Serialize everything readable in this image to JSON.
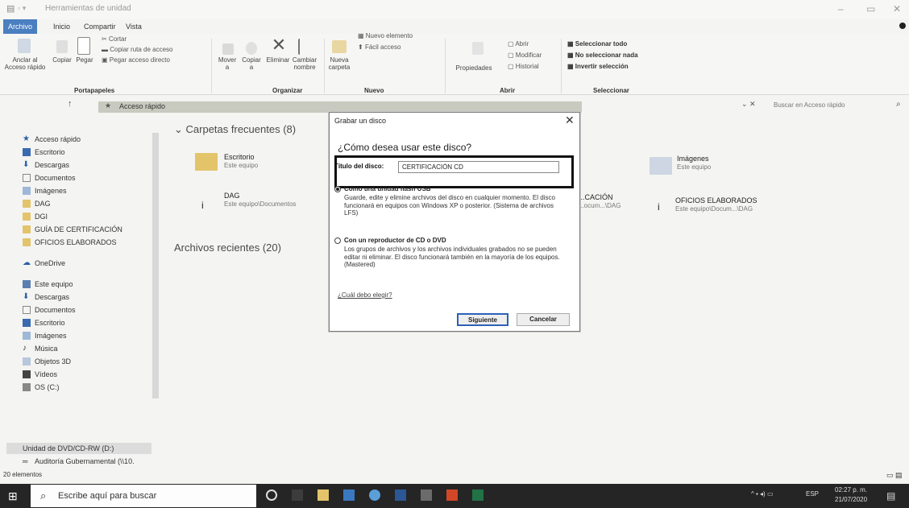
{
  "window": {
    "title": "Herramientas de unidad",
    "tabs": [
      "Archivo",
      "Inicio",
      "Compartir",
      "Vista"
    ]
  },
  "ribbon": {
    "portapapeles": {
      "pin_label": "Anclar al Acceso rápido",
      "copy_label": "Copiar",
      "paste_label": "Pegar",
      "cut_label": "Cortar",
      "copy_path_label": "Copiar ruta de acceso",
      "paste_shortcut_label": "Pegar acceso directo",
      "group_label": "Portapapeles"
    },
    "organizar": {
      "move_label": "Mover a",
      "copy_to_label": "Copiar a",
      "delete_label": "Eliminar",
      "rename_label": "Cambiar nombre",
      "group_label": "Organizar"
    },
    "nuevo": {
      "new_folder_label": "Nueva carpeta",
      "new_item_label": "Nuevo elemento",
      "easy_access_label": "Fácil acceso",
      "group_label": "Nuevo"
    },
    "abrir": {
      "properties_label": "Propiedades",
      "open_label": "Abrir",
      "modify_label": "Modificar",
      "history_label": "Historial",
      "group_label": "Abrir"
    },
    "seleccionar": {
      "select_all_label": "Seleccionar todo",
      "select_none_label": "No seleccionar nada",
      "invert_label": "Invertir selección",
      "group_label": "Seleccionar"
    }
  },
  "address": {
    "path": "Acceso rápido",
    "search_placeholder": "Buscar en Acceso rápido"
  },
  "nav": {
    "quick_access": "Acceso rápido",
    "pinned": [
      "Escritorio",
      "Descargas",
      "Documentos",
      "Imágenes",
      "DAG",
      "DGI",
      "GUÍA DE CERTIFICACIÓN",
      "OFICIOS ELABORADOS"
    ],
    "onedrive": "OneDrive",
    "this_pc": "Este equipo",
    "pc_items": [
      "Descargas",
      "Documentos",
      "Escritorio",
      "Imágenes",
      "Música",
      "Objetos 3D",
      "Vídeos",
      "OS (C:)"
    ],
    "dvd": "Unidad de DVD/CD-RW (D:)",
    "network": "Auditoría Gubernamental (\\\\10."
  },
  "content": {
    "frequent_header": "Carpetas frecuentes (8)",
    "recent_header": "Archivos recientes (20)",
    "folders": [
      {
        "name": "Escritorio",
        "sub": "Este equipo"
      },
      {
        "name": "Imágenes",
        "sub": "Este equipo"
      },
      {
        "name": "DAG",
        "sub": "Este equipo\\Documentos"
      },
      {
        "name": "...CACIÓN",
        "sub": "...ocum...\\DAG"
      },
      {
        "name": "OFICIOS ELABORADOS",
        "sub": "Este equipo\\Docum...\\DAG"
      }
    ]
  },
  "dialog": {
    "title": "Grabar un disco",
    "question": "¿Cómo desea usar este disco?",
    "disc_title_label": "Título del disco:",
    "disc_title_value": "CERTIFICACIÓN CD",
    "option1_title": "Como una unidad flash USB",
    "option1_desc": "Guarde, edite y elimine archivos del disco en cualquier momento. El disco funcionará en equipos con Windows XP o posterior. (Sistema de archivos LFS)",
    "option2_title": "Con un reproductor de CD o DVD",
    "option2_desc": "Los grupos de archivos y los archivos individuales grabados no se pueden editar ni eliminar. El disco funcionará también en la mayoría de los equipos. (Mastered)",
    "help_link": "¿Cuál debo elegir?",
    "next_label": "Siguiente",
    "cancel_label": "Cancelar"
  },
  "status": {
    "items_count": "20 elementos"
  },
  "taskbar": {
    "search_placeholder": "Escribe aquí para buscar",
    "time": "02:27 p. m.",
    "date": "21/07/2020"
  },
  "colors": {
    "accent": "#4a7fc0",
    "taskbar": "#252525",
    "folder": "#e3c46b"
  }
}
